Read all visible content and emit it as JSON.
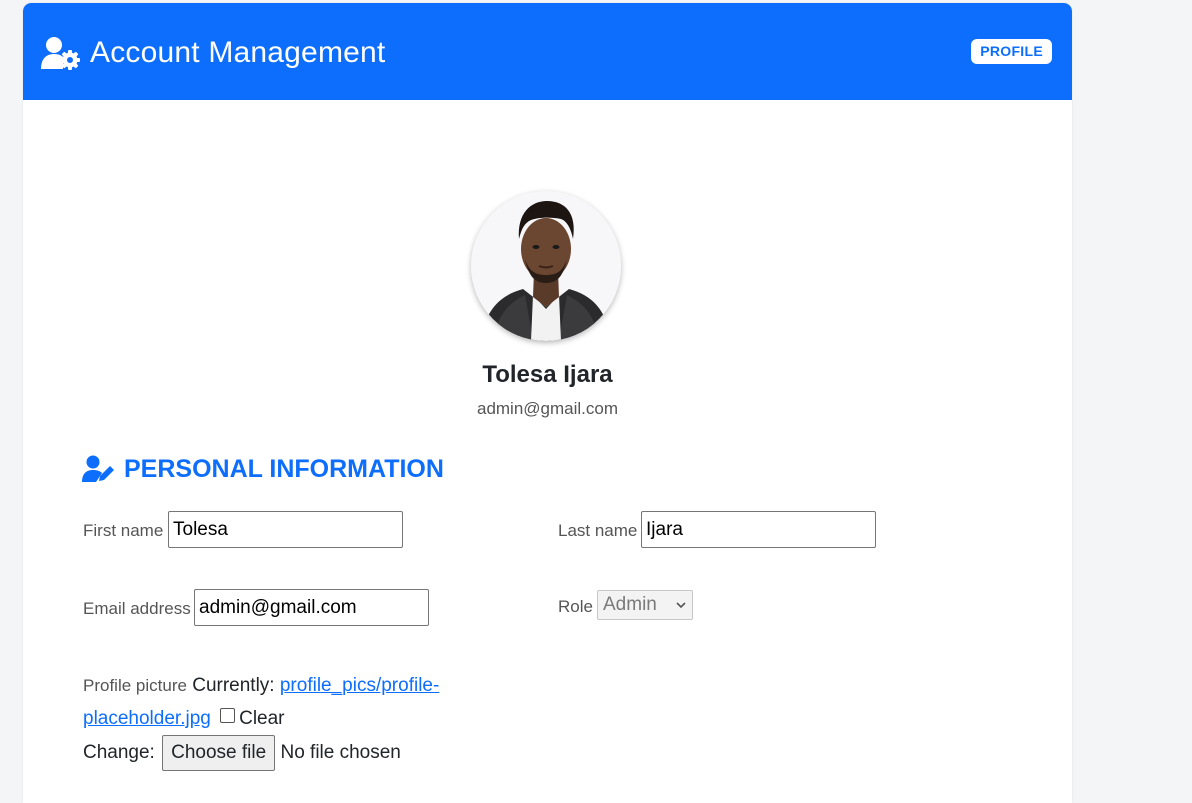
{
  "header": {
    "title": "Account Management",
    "badge": "PROFILE",
    "icon": "user-gear-icon"
  },
  "profile": {
    "name": "Tolesa Ijara",
    "email": "admin@gmail.com",
    "avatar": "profile-photo"
  },
  "section": {
    "title": "PERSONAL INFORMATION",
    "icon": "user-pen-icon"
  },
  "form": {
    "first_name_label": "First name",
    "first_name_value": "Tolesa",
    "last_name_label": "Last name",
    "last_name_value": "Ijara",
    "email_label": "Email address",
    "email_value": "admin@gmail.com",
    "role_label": "Role",
    "role_value": "Admin",
    "picture_label": "Profile picture",
    "currently_label": "Currently:",
    "current_file": "profile_pics/profile-placeholder.jpg",
    "clear_label": "Clear",
    "change_label": "Change:",
    "choose_file_label": "Choose file",
    "no_file_text": "No file chosen"
  },
  "colors": {
    "primary": "#0d6efd",
    "background": "#f4f5f7"
  }
}
